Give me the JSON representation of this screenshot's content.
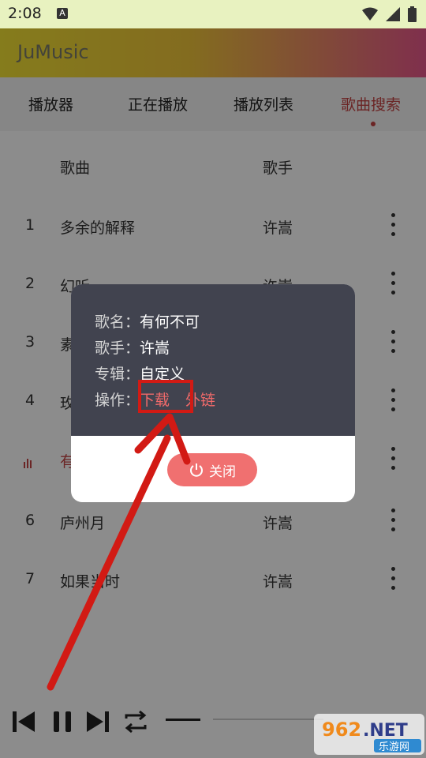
{
  "status_bar": {
    "time": "2:08",
    "notif_letter": "A"
  },
  "app": {
    "title": "JuMusic"
  },
  "tabs": [
    "播放器",
    "正在播放",
    "播放列表",
    "歌曲搜索"
  ],
  "list": {
    "header": {
      "song": "歌曲",
      "artist": "歌手"
    },
    "rows": [
      {
        "num": "1",
        "title": "多余的解释",
        "artist": "许嵩"
      },
      {
        "num": "2",
        "title": "幻听",
        "artist": "许嵩"
      },
      {
        "num": "3",
        "title": "素",
        "artist": ""
      },
      {
        "num": "4",
        "title": "玫",
        "artist": ""
      },
      {
        "num": "",
        "title": "有",
        "artist": ""
      },
      {
        "num": "6",
        "title": "庐州月",
        "artist": "许嵩"
      },
      {
        "num": "7",
        "title": "如果当时",
        "artist": "许嵩"
      }
    ]
  },
  "dialog": {
    "song_label": "歌名：",
    "song_value": "有何不可",
    "artist_label": "歌手：",
    "artist_value": "许嵩",
    "album_label": "专辑：",
    "album_value": "自定义",
    "action_label": "操作：",
    "download": "下载",
    "external_link": "外链",
    "close": "关闭"
  },
  "watermark": {
    "brand": "962.NET",
    "sub": "乐游网"
  },
  "colors": {
    "accent": "#c44444",
    "dialog_top": "#41434f",
    "close_button": "#f07070",
    "highlight": "#d21a14"
  }
}
